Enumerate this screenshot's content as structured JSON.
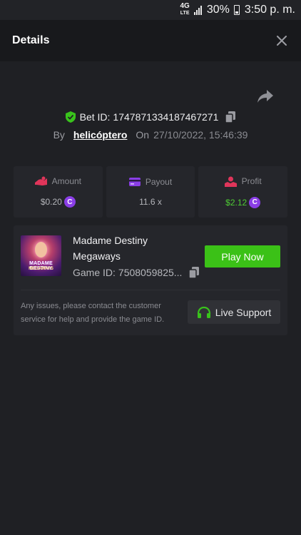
{
  "status_bar": {
    "network": "4G",
    "network_sub": "LTE",
    "battery": "30%",
    "time": "3:50 p. m."
  },
  "header": {
    "title": "Details"
  },
  "bet": {
    "id_label": "Bet ID:",
    "id_value": "1747871334187467271",
    "by_label": "By",
    "username": "helicóptero",
    "on_label": "On",
    "date": "27/10/2022, 15:46:39"
  },
  "stats": {
    "amount": {
      "label": "Amount",
      "value": "$0.20"
    },
    "payout": {
      "label": "Payout",
      "value": "11.6 x"
    },
    "profit": {
      "label": "Profit",
      "value": "$2.12"
    },
    "coin_glyph": "C"
  },
  "game": {
    "thumb_title": "MADAME DESTINY",
    "thumb_subtitle": "MEGAWAYS",
    "name": "Madame Destiny Megaways",
    "id_label": "Game ID:",
    "id_value": "7508059825...",
    "play_label": "Play Now"
  },
  "support": {
    "text": "Any issues, please contact the customer service for help and provide the game ID.",
    "button_label": "Live Support"
  },
  "colors": {
    "accent_green": "#3bc117",
    "profit_green": "#4ecb34",
    "coin_purple": "#8a3ee6",
    "amount_icon": "#e0355a",
    "payout_icon": "#8a3ee6",
    "profit_icon": "#e0355a",
    "shield_green": "#39c21c"
  }
}
